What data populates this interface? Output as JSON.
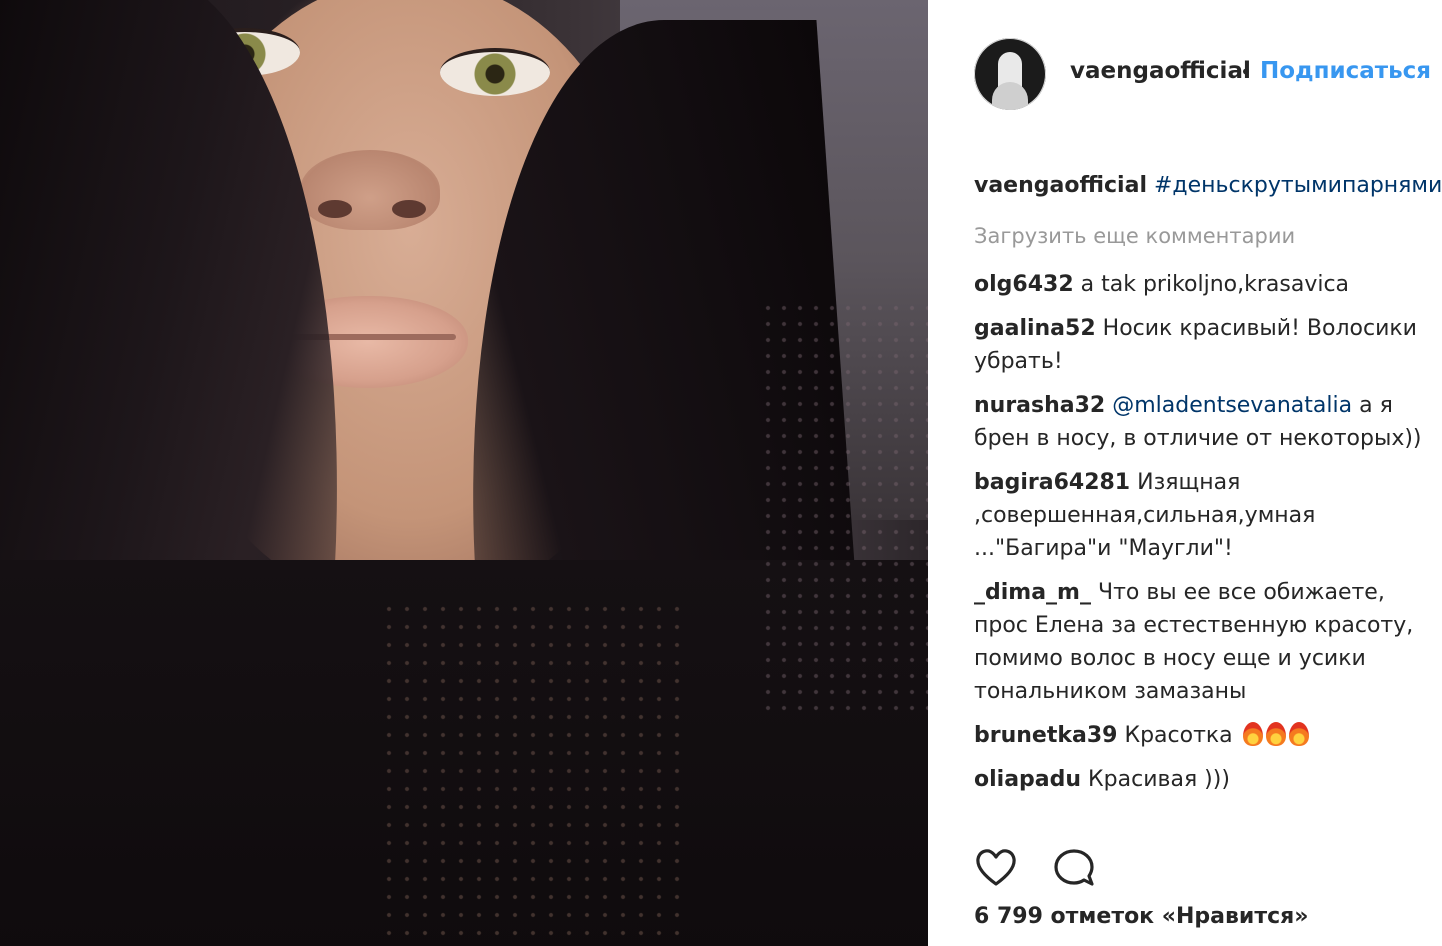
{
  "photo": {
    "description_icon": "selfie-photo"
  },
  "header": {
    "username": "vaengaofficial",
    "separator": "•",
    "follow_label": "Подписаться"
  },
  "caption": {
    "username": "vaengaofficial",
    "text": "#деньскрутымипарнями("
  },
  "load_more_label": "Загрузить еще комментарии",
  "comments": [
    {
      "user": "olg6432",
      "text": "a tak prikoljno,krasavica"
    },
    {
      "user": "gaalina52",
      "text": "Носик красивый! Волосики убрать!"
    },
    {
      "user": "nurasha32",
      "mention": "@mladentsevanatalia",
      "text": "а я брен в носу, в отличие от некоторых))"
    },
    {
      "user": "bagira64281",
      "text": "Изящная ,совершенная,сильная,умная ...\"Багира\"и \"Маугли\"!"
    },
    {
      "user": "_dima_m_",
      "text": "Что вы ее все обижаете, прос Елена за естественную красоту, помимо волос в носу еще и усики тональником замазаны"
    },
    {
      "user": "brunetka39",
      "text": "Красотка"
    },
    {
      "user": "oliapadu",
      "text": "Красивая )))"
    }
  ],
  "actions": {
    "like_icon": "heart-icon",
    "comment_icon": "comment-bubble-icon"
  },
  "likes_text": "6 799 отметок «Нравится»",
  "colors": {
    "link": "#3897f0",
    "hashtag": "#003569",
    "muted": "#999999",
    "text": "#262626"
  }
}
